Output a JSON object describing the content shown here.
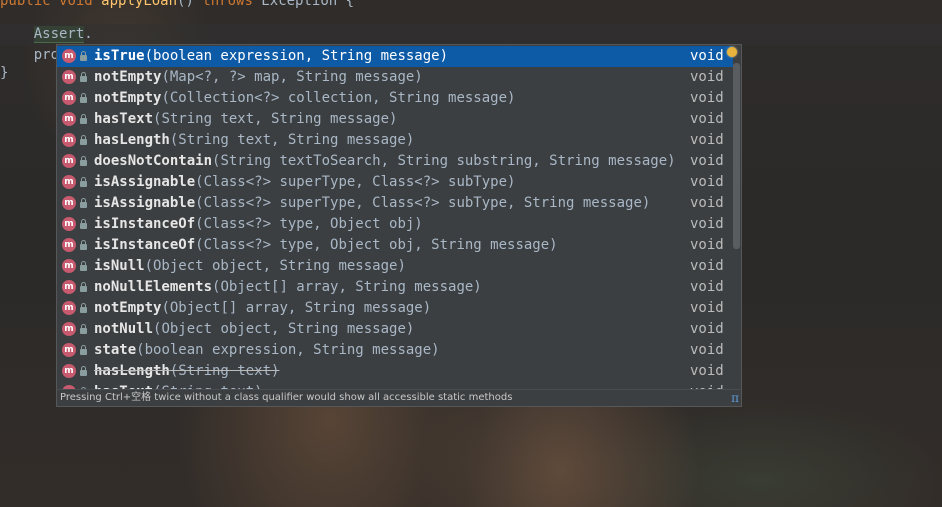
{
  "editor": {
    "line1": {
      "modifier": "public",
      "type": "void",
      "method": "applyLoan",
      "parens": "()",
      "throws": "throws",
      "exception": "Exception {"
    },
    "line2": {
      "indent": "    ",
      "token": "Assert",
      "dot": "."
    },
    "line3": {
      "indent": "    ",
      "text": "pro"
    },
    "line4": {
      "text": "}"
    }
  },
  "completion": {
    "items": [
      {
        "name": "isTrue",
        "params": "(boolean expression, String message)",
        "return": "void",
        "selected": true
      },
      {
        "name": "notEmpty",
        "params": "(Map<?, ?> map, String message)",
        "return": "void"
      },
      {
        "name": "notEmpty",
        "params": "(Collection<?> collection, String message)",
        "return": "void"
      },
      {
        "name": "hasText",
        "params": "(String text, String message)",
        "return": "void"
      },
      {
        "name": "hasLength",
        "params": "(String text, String message)",
        "return": "void"
      },
      {
        "name": "doesNotContain",
        "params": "(String textToSearch, String substring, String message)",
        "return": "void"
      },
      {
        "name": "isAssignable",
        "params": "(Class<?> superType, Class<?> subType)",
        "return": "void"
      },
      {
        "name": "isAssignable",
        "params": "(Class<?> superType, Class<?> subType, String message)",
        "return": "void"
      },
      {
        "name": "isInstanceOf",
        "params": "(Class<?> type, Object obj)",
        "return": "void"
      },
      {
        "name": "isInstanceOf",
        "params": "(Class<?> type, Object obj, String message)",
        "return": "void"
      },
      {
        "name": "isNull",
        "params": "(Object object, String message)",
        "return": "void"
      },
      {
        "name": "noNullElements",
        "params": "(Object[] array, String message)",
        "return": "void"
      },
      {
        "name": "notEmpty",
        "params": "(Object[] array, String message)",
        "return": "void"
      },
      {
        "name": "notNull",
        "params": "(Object object, String message)",
        "return": "void"
      },
      {
        "name": "state",
        "params": "(boolean expression, String message)",
        "return": "void"
      },
      {
        "name": "hasLength",
        "params": "(String text)",
        "return": "void",
        "deprecated": true
      },
      {
        "name": "hasText",
        "params": "(String text)",
        "return": "void",
        "deprecated": true,
        "cut": true
      }
    ],
    "icon_letter": "m",
    "footer_hint": "Pressing Ctrl+空格 twice without a class qualifier would show all accessible static methods",
    "footer_icon": "π"
  },
  "colors": {
    "selection": "#0d5aa7",
    "popup_bg": "#3c3f41",
    "method_icon": "#c75a6e"
  }
}
